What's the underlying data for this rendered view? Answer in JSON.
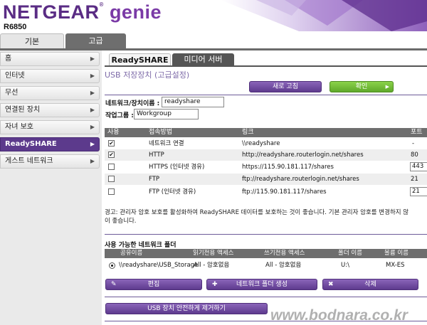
{
  "header": {
    "brand": "NETGEAR",
    "product": "genie",
    "trademark": "®",
    "model": "R6850"
  },
  "top_tabs": {
    "basic": "기본",
    "advanced": "고급"
  },
  "sidebar": {
    "items": [
      {
        "label": "홈"
      },
      {
        "label": "인터넷"
      },
      {
        "label": "무선"
      },
      {
        "label": "연결된 장치"
      },
      {
        "label": "자녀 보호"
      },
      {
        "label": "ReadySHARE"
      },
      {
        "label": "게스트 네트워크"
      }
    ],
    "active_index": 5
  },
  "sub_tabs": {
    "readyshare": "ReadySHARE",
    "media_server": "미디어 서버"
  },
  "page_title": "USB 저장장치 (고급설정)",
  "buttons": {
    "refresh": "새로 고침",
    "apply": "확인",
    "edit": "편집",
    "create_folder": "네트워크 폴더 생성",
    "delete": "삭제",
    "safely_remove": "USB 장치 안전하게 제거하기"
  },
  "form": {
    "device_name_label": "네트워크/장치이름 :",
    "device_name_value": "readyshare",
    "workgroup_label": "작업그룹 :",
    "workgroup_value": "Workgroup"
  },
  "access_table": {
    "headers": {
      "enable": "사용",
      "method": "접속방법",
      "link": "링크",
      "port": "포트"
    },
    "rows": [
      {
        "checked": true,
        "method": "네트워크 연결",
        "link": "\\\\readyshare",
        "port": "-"
      },
      {
        "checked": true,
        "method": "HTTP",
        "link": "http://readyshare.routerlogin.net/shares",
        "port": "80"
      },
      {
        "checked": false,
        "method": "HTTPS (인터넷 경유)",
        "link": "https://115.90.181.117/shares",
        "port": "443"
      },
      {
        "checked": false,
        "method": "FTP",
        "link": "ftp://readyshare.routerlogin.net/shares",
        "port": "21"
      },
      {
        "checked": false,
        "method": "FTP (인터넷 경유)",
        "link": "ftp://115.90.181.117/shares",
        "port": "21"
      }
    ]
  },
  "warning": {
    "line1": "경고: 관리자 암호 보호를 활성화하여 ReadySHARE 데이터를 보호하는 것이 좋습니다. 기본 관리자 암호를 변경하지 않",
    "line2": "이 좋습니다."
  },
  "folders": {
    "title": "사용 가능한 네트워크 폴더",
    "headers": {
      "share": "공유이름",
      "read": "읽기전용 액세스",
      "write": "쓰기전용 액세스",
      "folder": "폴더 이름",
      "volume": "볼륨 이름"
    },
    "rows": [
      {
        "share": "\\\\readyshare\\USB_Storage",
        "read": "All - 암호없음",
        "write": "All - 암호없음",
        "folder": "U:\\",
        "volume": "MX-ES"
      }
    ]
  },
  "watermark": "www.bodnara.co.kr",
  "colors": {
    "brand_purple": "#5a2c84",
    "active_sidebar": "#5c3a8c",
    "apply_green": "#6cb832",
    "table_header_gray": "#6e6e6e"
  }
}
